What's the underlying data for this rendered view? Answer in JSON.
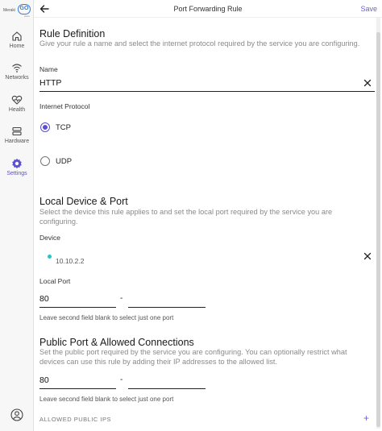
{
  "app": {
    "logo_text": "Meraki",
    "logo_mark": "GO",
    "logo_sub": "cisco"
  },
  "sidebar": {
    "items": [
      {
        "label": "Home",
        "icon": "home-icon"
      },
      {
        "label": "Networks",
        "icon": "wifi-icon"
      },
      {
        "label": "Health",
        "icon": "heart-pulse-icon"
      },
      {
        "label": "Hardware",
        "icon": "hardware-icon"
      },
      {
        "label": "Settings",
        "icon": "gear-icon",
        "active": true
      }
    ],
    "account_icon": "user-circle-icon"
  },
  "header": {
    "title": "Port Forwarding Rule",
    "save_label": "Save"
  },
  "rule_definition": {
    "heading": "Rule Definition",
    "description": "Give your rule a name and select the internet protocol required by the service you are configuring.",
    "name_label": "Name",
    "name_value": "HTTP",
    "protocol_label": "Internet Protocol",
    "protocols": [
      {
        "label": "TCP",
        "selected": true
      },
      {
        "label": "UDP",
        "selected": false
      }
    ]
  },
  "local_device": {
    "heading": "Local Device & Port",
    "description": "Select the device this rule applies to and set the local port required by the service you are configuring.",
    "device_label": "Device",
    "device_value": "10.10.2.2",
    "local_port_label": "Local Port",
    "port_start": "80",
    "port_end": "",
    "separator": "-",
    "hint": "Leave second field blank to select just one port"
  },
  "public_port": {
    "heading": "Public Port & Allowed Connections",
    "description": "Set the public port required by the service you are configuring. You can optionally restrict what devices can use this rule by adding their IP addresses to the allowed list.",
    "port_start": "80",
    "port_end": "",
    "separator": "-",
    "hint": "Leave second field blank to select just one port",
    "allowed_ips_label": "ALLOWED PUBLIC IPS"
  },
  "colors": {
    "accent": "#5b4fd0",
    "online_dot": "#25c6c6"
  }
}
